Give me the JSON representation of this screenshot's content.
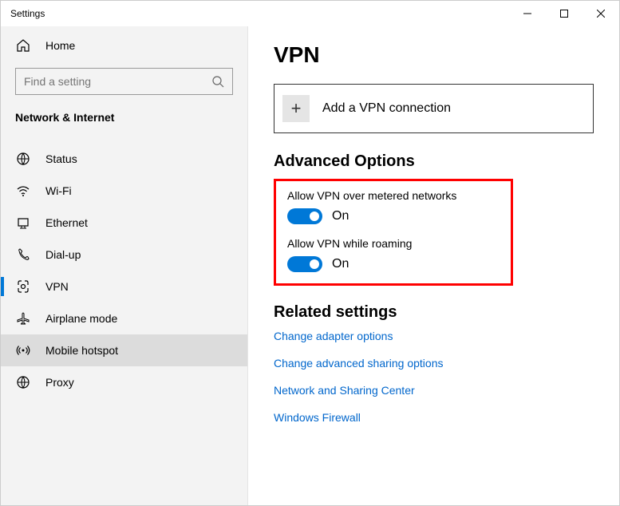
{
  "window": {
    "title": "Settings"
  },
  "sidebar": {
    "home": "Home",
    "search_placeholder": "Find a setting",
    "section": "Network & Internet",
    "items": [
      {
        "label": "Status"
      },
      {
        "label": "Wi-Fi"
      },
      {
        "label": "Ethernet"
      },
      {
        "label": "Dial-up"
      },
      {
        "label": "VPN"
      },
      {
        "label": "Airplane mode"
      },
      {
        "label": "Mobile hotspot"
      },
      {
        "label": "Proxy"
      }
    ]
  },
  "main": {
    "title": "VPN",
    "add_label": "Add a VPN connection",
    "advanced_heading": "Advanced Options",
    "opt1_label": "Allow VPN over metered networks",
    "opt1_state": "On",
    "opt2_label": "Allow VPN while roaming",
    "opt2_state": "On",
    "related_heading": "Related settings",
    "links": {
      "adapter": "Change adapter options",
      "sharing": "Change advanced sharing options",
      "center": "Network and Sharing Center",
      "firewall": "Windows Firewall"
    }
  }
}
